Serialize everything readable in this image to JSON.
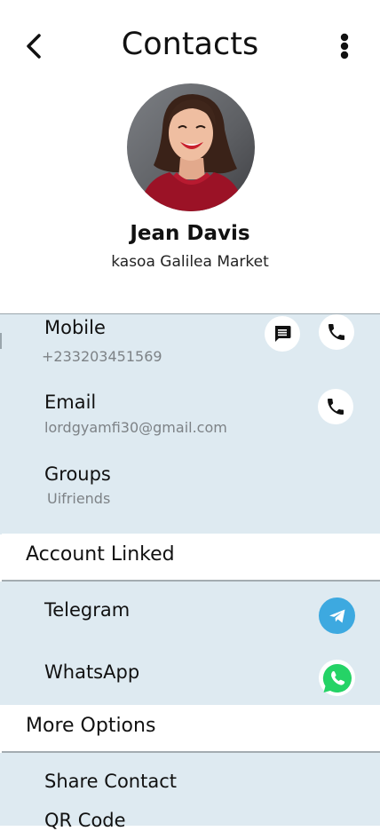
{
  "header": {
    "title": "Contacts"
  },
  "profile": {
    "name": "Jean Davis",
    "address": "kasoa Galilea Market"
  },
  "details": {
    "mobile_label": "Mobile",
    "mobile_value": "+233203451569",
    "email_label": "Email",
    "email_value": "lordgyamfi30@gmail.com",
    "groups_label": "Groups",
    "groups_value": "Uifriends"
  },
  "accounts": {
    "header": "Account Linked",
    "telegram_label": "Telegram",
    "whatsapp_label": "WhatsApp"
  },
  "options": {
    "header": "More Options",
    "items": [
      "Share Contact",
      "QR Code"
    ]
  },
  "icons": {
    "back": "chevron-left-icon",
    "more": "more-vertical-icon",
    "message": "message-icon",
    "phone": "phone-icon",
    "telegram": "telegram-icon",
    "whatsapp": "whatsapp-icon"
  },
  "colors": {
    "section_bg": "#deeaf1",
    "telegram": "#3da9e0",
    "whatsapp": "#25d366"
  }
}
